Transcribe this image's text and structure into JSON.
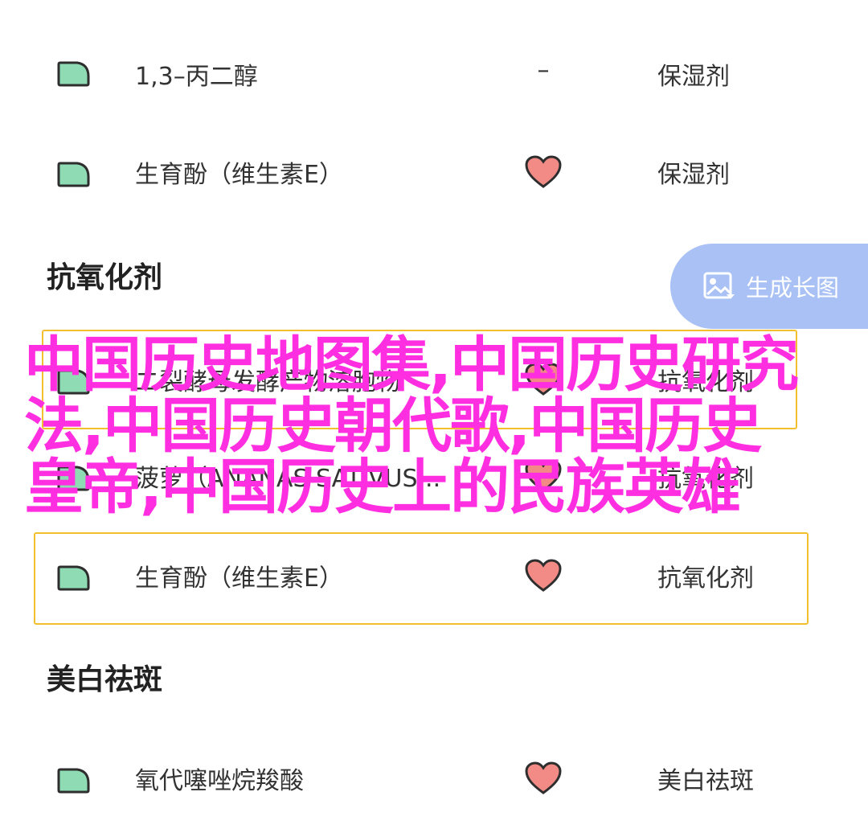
{
  "rows_top": [
    {
      "name": "1,3–丙二醇",
      "mid_text": "–",
      "function": "保湿剂",
      "rating": "none"
    },
    {
      "name": "生育酚（维生素E）",
      "mid_text": "",
      "function": "保湿剂",
      "rating": "heart"
    }
  ],
  "section_antioxidant": {
    "title": "抗氧化剂"
  },
  "generate_button": {
    "label": "生成长图",
    "icon": "image-icon"
  },
  "antioxidant_rows": [
    {
      "name": "二裂酵母发酵产物溶胞物",
      "function": "抗氧化剂",
      "rating": "heart"
    },
    {
      "name": "菠萝（ANANAS SATIVUS...",
      "function": "抗氧化剂",
      "rating": "heart"
    },
    {
      "name": "生育酚（维生素E）",
      "function": "抗氧化剂",
      "rating": "heart"
    }
  ],
  "section_whitening": {
    "title": "美白祛斑"
  },
  "whitening_rows": [
    {
      "name": "氧代噻唑烷羧酸",
      "function": "美白祛斑",
      "rating": "heart"
    }
  ],
  "overlay": {
    "lines": [
      "中国历史地图集,中国历史研究",
      "法,中国历史朝代歌,中国历史",
      "皇帝,中国历史上的民族英雄"
    ],
    "color": "#ff2ee0"
  },
  "colors": {
    "tag_fill": "#8fdcb4",
    "tag_stroke": "#2e2e2e",
    "heart_fill": "#f28b86",
    "highlight_border": "#f2bf2e",
    "button_bg": "#a9c1f4"
  }
}
